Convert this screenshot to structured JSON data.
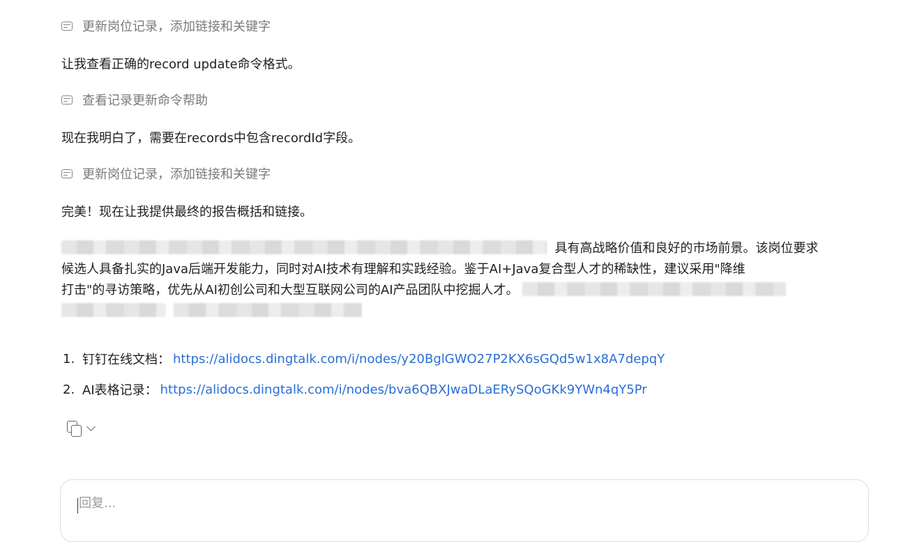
{
  "conversation": {
    "steps": [
      {
        "type": "tool",
        "icon": "tool-call-icon",
        "text": "更新岗位记录，添加链接和关键字"
      },
      {
        "type": "message",
        "text": "让我查看正确的record update命令格式。"
      },
      {
        "type": "tool",
        "icon": "tool-call-icon",
        "text": "查看记录更新命令帮助"
      },
      {
        "type": "message",
        "text": "现在我明白了，需要在records中包含recordId字段。"
      },
      {
        "type": "tool",
        "icon": "tool-call-icon",
        "text": "更新岗位记录，添加链接和关键字"
      },
      {
        "type": "message",
        "text": "完美！现在让我提供最终的报告概括和链接。"
      }
    ],
    "summary": {
      "line1_visible": "具有高战略价值和良好的市场前景。该岗位要求",
      "line2": "候选人具备扎实的Java后端开发能力，同时对AI技术有理解和实践经验。鉴于AI+Java复合型人才的稀缺性，建议采用\"降维",
      "line3_visible": "打击\"的寻访策略，优先从AI初创公司和大型互联网公司的AI产品团队中挖掘人才。"
    },
    "links": [
      {
        "number": "1.",
        "label": "钉钉在线文档：",
        "url": "https://alidocs.dingtalk.com/i/nodes/y20BglGWO27P2KX6sGQd5w1x8A7depqY"
      },
      {
        "number": "2.",
        "label": "AI表格记录：",
        "url": "https://alidocs.dingtalk.com/i/nodes/bva6QBXJwaDLaERySQoGKk9YWn4qY5Pr"
      }
    ],
    "actions": {
      "copy_icon": "copy-icon",
      "more_icon": "chevron-down-icon"
    }
  },
  "reply": {
    "placeholder": "回复..."
  }
}
